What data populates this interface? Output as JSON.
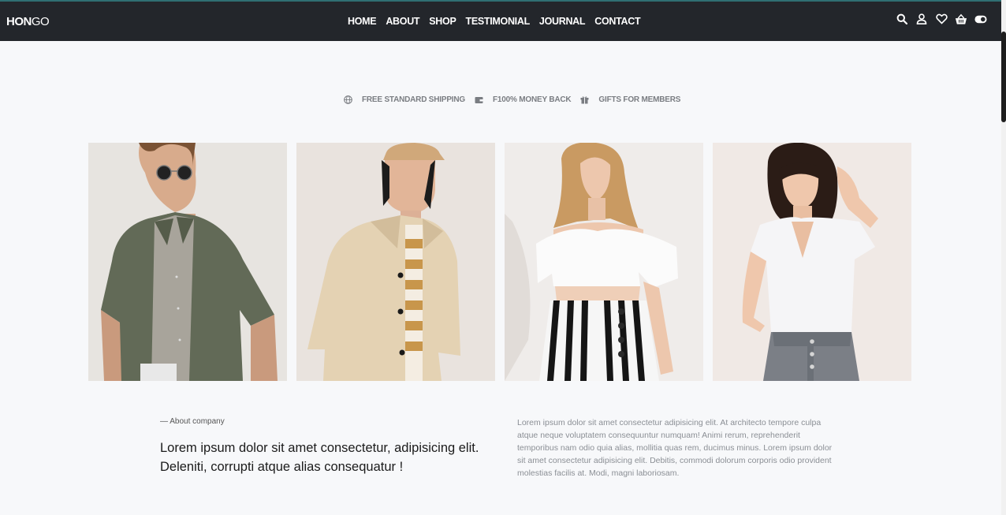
{
  "header": {
    "logo_bold": "HON",
    "logo_light": "GO",
    "nav": [
      "HOME",
      "ABOUT",
      "SHOP",
      "TESTIMONIAL",
      "JOURNAL",
      "CONTACT"
    ],
    "icons": [
      "search-icon",
      "user-icon",
      "heart-icon",
      "basket-icon",
      "toggle-icon"
    ]
  },
  "features": [
    {
      "icon": "globe-icon",
      "label": "FREE STANDARD SHIPPING"
    },
    {
      "icon": "wallet-icon",
      "label": "F100% MONEY BACK"
    },
    {
      "icon": "gift-icon",
      "label": "GIFTS FOR MEMBERS"
    }
  ],
  "about": {
    "label": "— About company",
    "heading": "Lorem ipsum dolor sit amet consectetur, adipisicing elit. Deleniti, corrupti atque alias consequatur !",
    "body": "Lorem ipsum dolor sit amet consectetur adipisicing elit. At architecto tempore culpa atque neque voluptatem consequuntur numquam! Animi rerum, reprehenderit temporibus nam odio quia alias, mollitia quas rem, ducimus minus. Lorem ipsum dolor sit amet consectetur adipisicing elit. Debitis, commodi dolorum corporis odio provident molestias facilis at. Modi, magni laboriosam."
  },
  "colors": {
    "nav_bg": "#23262b",
    "page_bg": "#f7f8fa",
    "muted_text": "#8b8f95"
  }
}
